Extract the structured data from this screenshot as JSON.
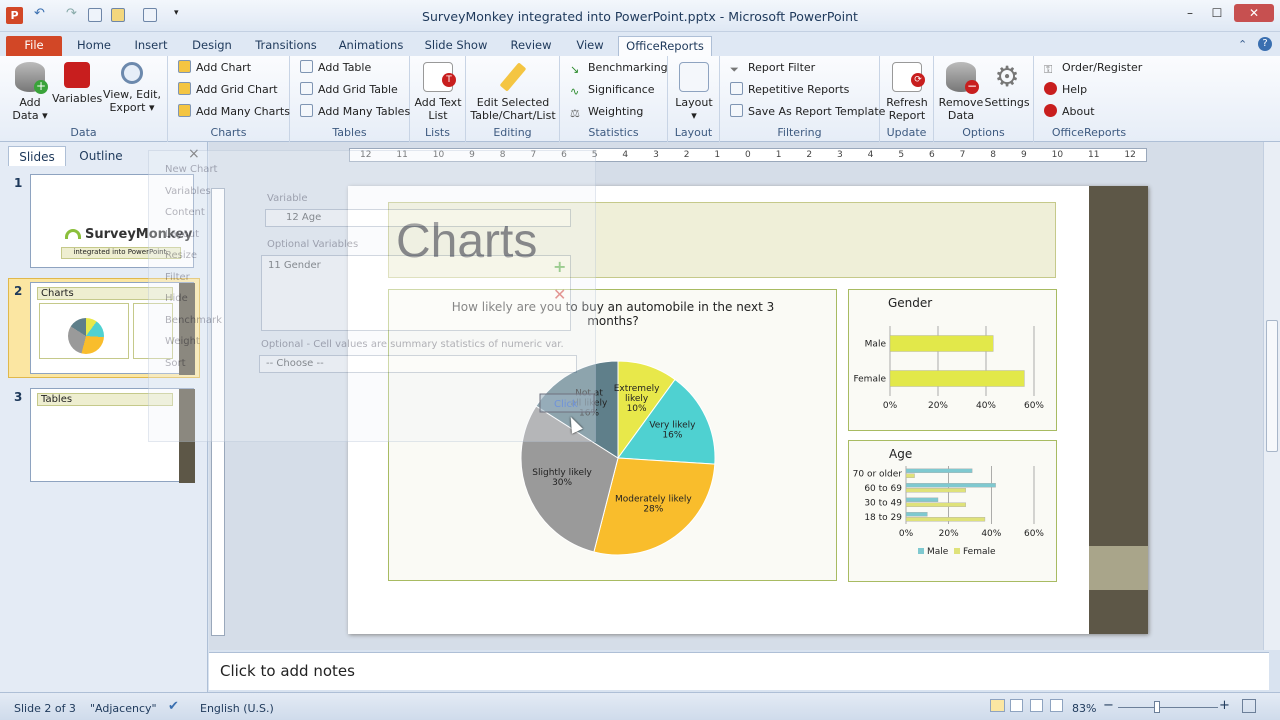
{
  "window": {
    "title": "SurveyMonkey integrated into PowerPoint.pptx - Microsoft PowerPoint",
    "minimize_label": "–",
    "maximize_label": "☐",
    "close_label": "✕"
  },
  "tabs": [
    "File",
    "Home",
    "Insert",
    "Design",
    "Transitions",
    "Animations",
    "Slide Show",
    "Review",
    "View",
    "OfficeReports"
  ],
  "ribbon": {
    "groups": {
      "data": "Data",
      "charts": "Charts",
      "tables": "Tables",
      "lists": "Lists",
      "editing": "Editing",
      "statistics": "Statistics",
      "layout": "Layout",
      "filtering": "Filtering",
      "update": "Update",
      "options": "Options",
      "officereports": "OfficeReports"
    },
    "add_data": "Add Data ▾",
    "variables": "Variables",
    "view_edit_export": "View, Edit, Export ▾",
    "add_chart": "Add Chart",
    "add_grid_chart": "Add Grid Chart",
    "add_many_charts": "Add Many Charts",
    "add_table": "Add Table",
    "add_grid_table": "Add Grid Table",
    "add_many_tables": "Add Many Tables",
    "add_text_list": "Add Text List",
    "edit_selected": "Edit Selected Table/Chart/List",
    "benchmarking": "Benchmarking",
    "significance": "Significance",
    "weighting": "Weighting",
    "layout_btn": "Layout ▾",
    "report_filter": "Report Filter",
    "repetitive_reports": "Repetitive Reports",
    "save_template": "Save As Report Template",
    "refresh_report": "Refresh Report",
    "remove_data": "Remove Data",
    "settings": "Settings",
    "order_register": "Order/Register",
    "help": "Help",
    "about": "About"
  },
  "left_pane": {
    "tab_slides": "Slides",
    "tab_outline": "Outline",
    "close": "×",
    "slides": [
      {
        "num": "1",
        "brand": "SurveyMonkey",
        "subtitle": "integrated into PowerPoint."
      },
      {
        "num": "2",
        "title": "Charts"
      },
      {
        "num": "3",
        "title": "Tables"
      }
    ]
  },
  "popup": {
    "menu": [
      "New Chart",
      "Variables",
      "Content",
      "Layout",
      "Resize",
      "Filter",
      "Hide",
      "Benchmark",
      "Weight",
      "Sort"
    ],
    "variable_label": "Variable",
    "variable_value": "12 Age",
    "optional_variables_label": "Optional Variables",
    "optional_variables_value": "11 Gender",
    "summary_label": "Optional - Cell values are summary statistics of numeric var.",
    "choose_value": "-- Choose --"
  },
  "ruler": {
    "ticks": [
      "12",
      "11",
      "10",
      "9",
      "8",
      "7",
      "6",
      "5",
      "4",
      "3",
      "2",
      "1",
      "0",
      "1",
      "2",
      "3",
      "4",
      "5",
      "6",
      "7",
      "8",
      "9",
      "10",
      "11",
      "12"
    ]
  },
  "slide": {
    "title": "Charts",
    "pie_chart": {
      "title": "How likely are you to buy an automobile in the next 3 months?",
      "slices": [
        {
          "label": "Extremely likely",
          "value": 10,
          "display": "10%",
          "color": "#e8e84a"
        },
        {
          "label": "Very likely",
          "value": 16,
          "display": "16%",
          "color": "#4fd1d1"
        },
        {
          "label": "Moderately likely",
          "value": 28,
          "display": "28%",
          "color": "#f9bd2c"
        },
        {
          "label": "Slightly likely",
          "value": 30,
          "display": "30%",
          "color": "#9a9a9a"
        },
        {
          "label": "Not at all likely",
          "value": 16,
          "display": "16%",
          "color": "#5f7f8a"
        }
      ],
      "selected_label": "Click"
    },
    "gender_chart": {
      "title": "Gender",
      "categories": [
        "Male",
        "Female"
      ],
      "values": [
        43,
        56
      ],
      "ticks": [
        "0%",
        "20%",
        "40%",
        "60%"
      ],
      "xmax": 60,
      "color": "#e2e84a"
    },
    "age_chart": {
      "title": "Age",
      "categories": [
        "70 or older",
        "60 to 69",
        "30 to 49",
        "18 to 29"
      ],
      "series": [
        {
          "name": "Male",
          "values": [
            31,
            42,
            15,
            10
          ],
          "color": "#7fc9d0"
        },
        {
          "name": "Female",
          "values": [
            4,
            28,
            28,
            37
          ],
          "color": "#dfe27a"
        }
      ],
      "ticks": [
        "0%",
        "20%",
        "40%",
        "60%"
      ],
      "xmax": 60
    }
  },
  "notes": {
    "placeholder": "Click to add notes"
  },
  "status": {
    "slide": "Slide 2 of 3",
    "theme": "\"Adjacency\"",
    "language": "English (U.S.)",
    "zoom": "83%",
    "zoom_minus": "−",
    "zoom_plus": "+"
  }
}
